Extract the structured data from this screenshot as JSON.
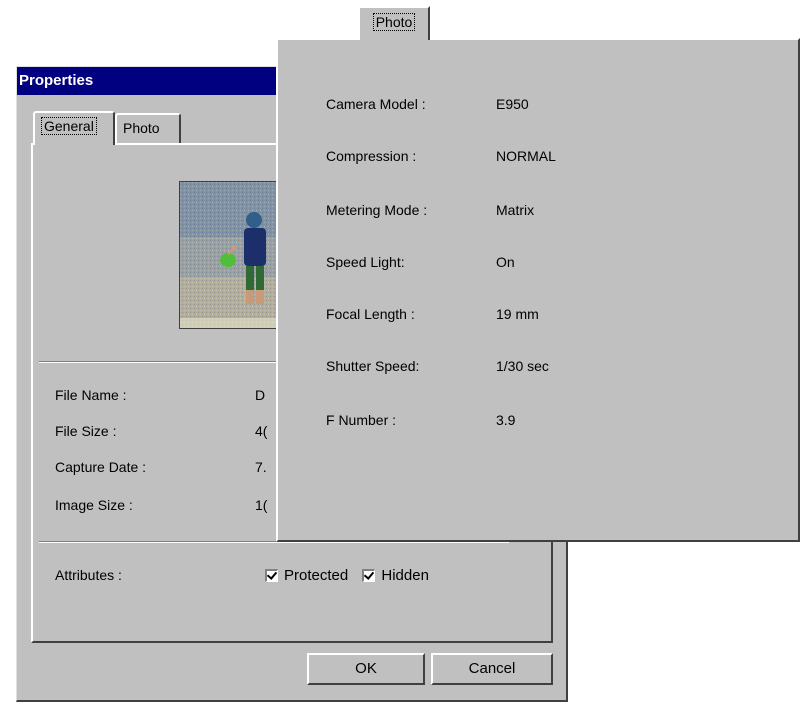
{
  "dialog": {
    "title": "Properties",
    "tabs": [
      "General",
      "Photo"
    ],
    "fields": [
      {
        "label": "File Name :",
        "value_visible": "D"
      },
      {
        "label": "File Size :",
        "value_visible": "4("
      },
      {
        "label": "Capture Date :",
        "value_visible": "7."
      },
      {
        "label": "Image Size :",
        "value_visible": "1("
      }
    ],
    "attributes_label": "Attributes :",
    "checkboxes": [
      {
        "label": "Protected",
        "checked": true
      },
      {
        "label": "Hidden",
        "checked": true
      }
    ],
    "buttons": {
      "ok": "OK",
      "cancel": "Cancel"
    }
  },
  "popup": {
    "tab_label": "Photo",
    "rows": [
      {
        "label": "Camera Model :",
        "value": "E950"
      },
      {
        "label": "Compression :",
        "value": "NORMAL"
      },
      {
        "label": "Metering Mode :",
        "value": "Matrix"
      },
      {
        "label": "Speed Light:",
        "value": "On"
      },
      {
        "label": "Focal Length :",
        "value": "19 mm"
      },
      {
        "label": "Shutter Speed:",
        "value": "1/30 sec"
      },
      {
        "label": "F Number :",
        "value": "3.9"
      }
    ]
  },
  "colors": {
    "face": "#c0c0c0",
    "titlebar": "#000080"
  }
}
